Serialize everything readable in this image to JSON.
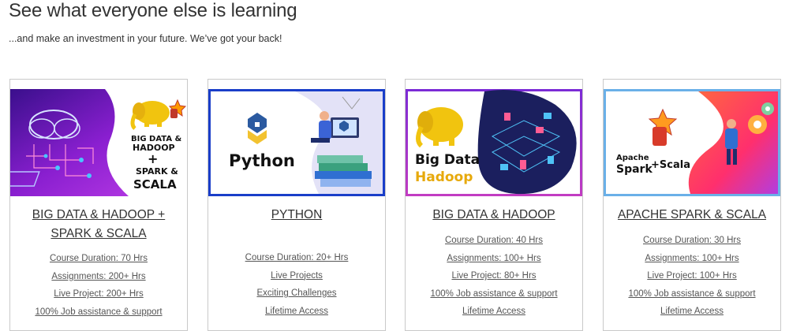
{
  "section": {
    "title": "See what everyone else is learning",
    "subtitle": "...and make an investment in your future. We’ve got your back!"
  },
  "cards": [
    {
      "title": "BIG DATA & HADOOP + SPARK & SCALA",
      "image_text": [
        "BIG DATA &",
        "HADOOP",
        "+",
        "SPARK &",
        "SCALA"
      ],
      "features": [
        "Course Duration: 70 Hrs",
        "Assignments: 200+ Hrs",
        "Live Project: 200+ Hrs",
        "100% Job assistance & support"
      ]
    },
    {
      "title": "PYTHON",
      "image_text": [
        "Python"
      ],
      "features": [
        "Course Duration: 20+ Hrs",
        "Live Projects",
        "Exciting Challenges",
        "Lifetime Access"
      ]
    },
    {
      "title": "BIG DATA & HADOOP",
      "image_text": [
        "Big Data",
        "Hadoop"
      ],
      "features": [
        "Course Duration: 40 Hrs",
        "Assignments: 100+ Hrs",
        "Live Project: 80+ Hrs",
        "100% Job assistance & support",
        "Lifetime Access"
      ]
    },
    {
      "title": "APACHE SPARK & SCALA",
      "image_text": [
        "Apache",
        "Spark",
        "+Scala"
      ],
      "features": [
        "Course Duration: 30 Hrs",
        "Assignments: 100+ Hrs",
        "Live Project: 100+ Hrs",
        "100% Job assistance & support",
        "Lifetime Access"
      ]
    }
  ]
}
